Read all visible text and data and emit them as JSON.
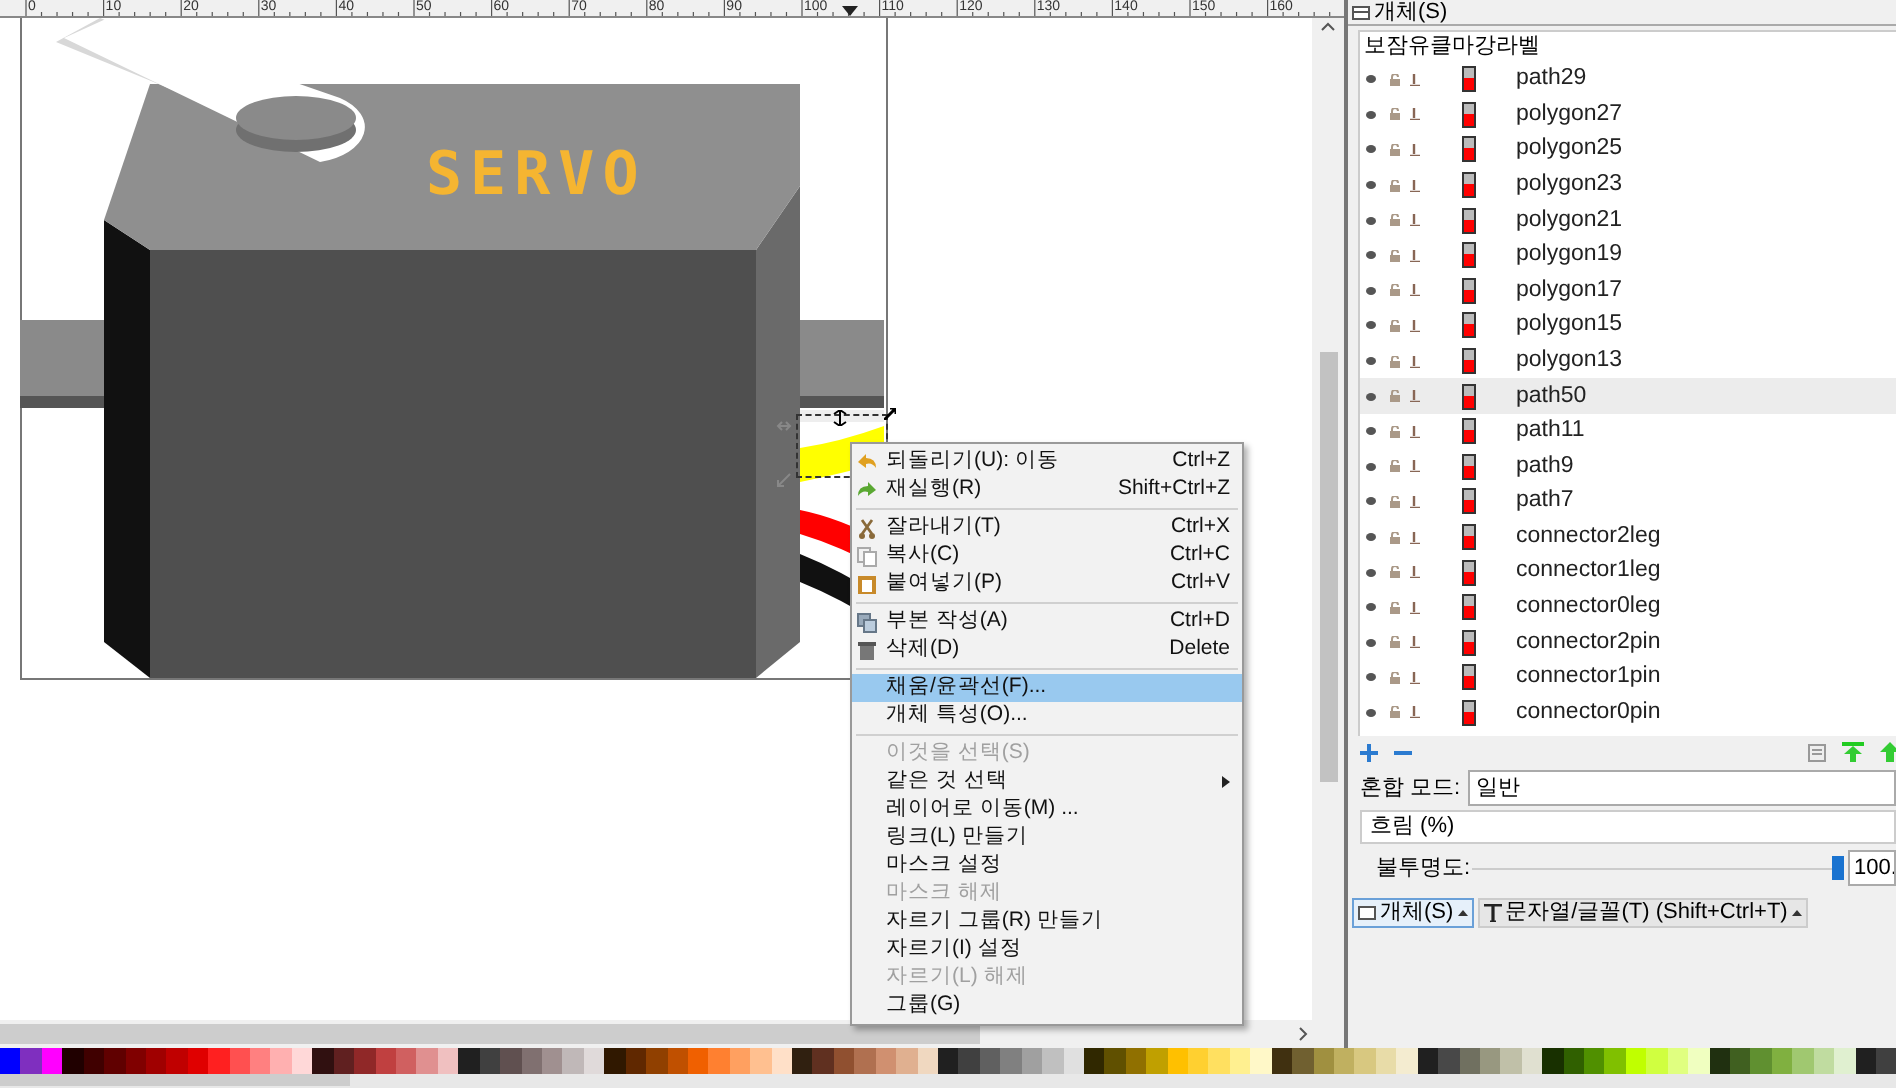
{
  "ruler": {
    "labels": [
      "0",
      "10",
      "20",
      "30",
      "40",
      "50",
      "60",
      "70",
      "80",
      "90",
      "100",
      "110",
      "120",
      "130",
      "140",
      "150",
      "160"
    ]
  },
  "drawing": {
    "logo_text": "SERVO"
  },
  "context_menu": {
    "items": [
      {
        "kind": "item",
        "label": "되돌리기(U): 이동",
        "shortcut": "Ctrl+Z",
        "disabled": false,
        "selected": false
      },
      {
        "kind": "item",
        "label": "재실행(R)",
        "shortcut": "Shift+Ctrl+Z",
        "disabled": false,
        "selected": false
      },
      {
        "kind": "separator"
      },
      {
        "kind": "item",
        "label": "잘라내기(T)",
        "shortcut": "Ctrl+X",
        "disabled": false,
        "selected": false
      },
      {
        "kind": "item",
        "label": "복사(C)",
        "shortcut": "Ctrl+C",
        "disabled": false,
        "selected": false
      },
      {
        "kind": "item",
        "label": "붙여넣기(P)",
        "shortcut": "Ctrl+V",
        "disabled": false,
        "selected": false
      },
      {
        "kind": "separator"
      },
      {
        "kind": "item",
        "label": "부본 작성(A)",
        "shortcut": "Ctrl+D",
        "disabled": false,
        "selected": false
      },
      {
        "kind": "item",
        "label": "삭제(D)",
        "shortcut": "Delete",
        "disabled": false,
        "selected": false
      },
      {
        "kind": "separator"
      },
      {
        "kind": "item",
        "label": "채움/윤곽선(F)...",
        "disabled": false,
        "selected": true
      },
      {
        "kind": "item",
        "label": "개체 특성(O)...",
        "disabled": false,
        "selected": false
      },
      {
        "kind": "separator"
      },
      {
        "kind": "item",
        "label": "이것을 선택(S)",
        "disabled": true,
        "selected": false
      },
      {
        "kind": "submenu",
        "label": "같은 것 선택",
        "disabled": false,
        "selected": false
      },
      {
        "kind": "item",
        "label": "레이어로 이동(M) ...",
        "disabled": false,
        "selected": false
      },
      {
        "kind": "item",
        "label": "링크(L) 만들기",
        "disabled": false,
        "selected": false
      },
      {
        "kind": "item",
        "label": "마스크 설정",
        "disabled": false,
        "selected": false
      },
      {
        "kind": "item",
        "label": "마스크 해제",
        "disabled": true,
        "selected": false
      },
      {
        "kind": "item",
        "label": "자르기 그룹(R) 만들기",
        "disabled": false,
        "selected": false
      },
      {
        "kind": "item",
        "label": "자르기(I) 설정",
        "disabled": false,
        "selected": false
      },
      {
        "kind": "item",
        "label": "자르기(L) 해제",
        "disabled": true,
        "selected": false
      },
      {
        "kind": "item",
        "label": "그룹(G)",
        "disabled": false,
        "selected": false
      }
    ]
  },
  "objects_panel": {
    "title": "개체(S)",
    "columns": [
      "보",
      "잠",
      "유",
      "클",
      "마",
      "강",
      "라벨"
    ],
    "rows": [
      {
        "label": "path29",
        "selected": false
      },
      {
        "label": "polygon27",
        "selected": false
      },
      {
        "label": "polygon25",
        "selected": false
      },
      {
        "label": "polygon23",
        "selected": false
      },
      {
        "label": "polygon21",
        "selected": false
      },
      {
        "label": "polygon19",
        "selected": false
      },
      {
        "label": "polygon17",
        "selected": false
      },
      {
        "label": "polygon15",
        "selected": false
      },
      {
        "label": "polygon13",
        "selected": false
      },
      {
        "label": "path50",
        "selected": true
      },
      {
        "label": "path11",
        "selected": false
      },
      {
        "label": "path9",
        "selected": false
      },
      {
        "label": "path7",
        "selected": false
      },
      {
        "label": "connector2leg",
        "selected": false
      },
      {
        "label": "connector1leg",
        "selected": false
      },
      {
        "label": "connector0leg",
        "selected": false
      },
      {
        "label": "connector2pin",
        "selected": false
      },
      {
        "label": "connector1pin",
        "selected": false
      },
      {
        "label": "connector0pin",
        "selected": false
      }
    ],
    "blend_label": "혼합 모드:",
    "blend_value": "일반",
    "blur_label": "흐림 (%)",
    "opacity_label": "불투명도:",
    "opacity": {
      "level": 1.0,
      "reading": "100."
    }
  },
  "dock_tabs": [
    {
      "label": "개체(S)",
      "selected": true
    },
    {
      "label": "문자열/글꼴(T) (Shift+Ctrl+T)",
      "selected": false
    }
  ]
}
